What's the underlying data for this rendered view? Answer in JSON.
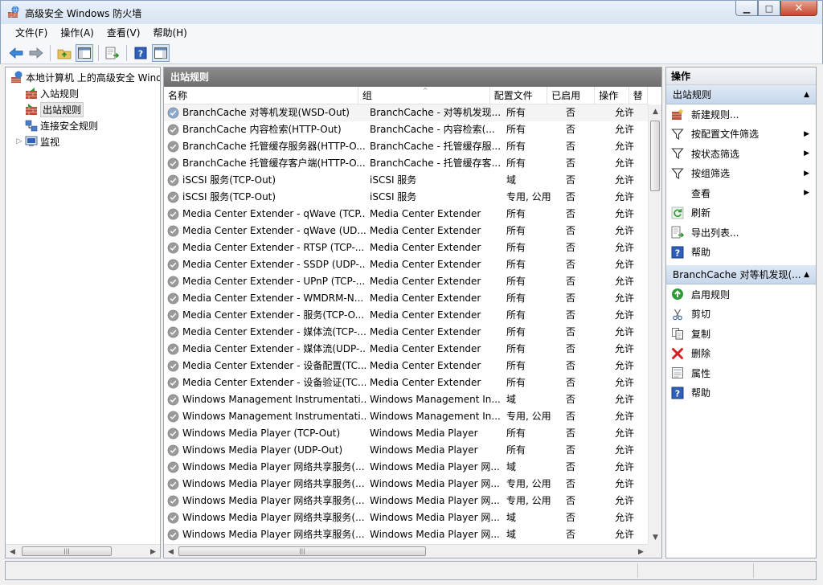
{
  "window": {
    "title": "高级安全 Windows 防火墙",
    "minimize_glyph": "▁",
    "maximize_glyph": "□",
    "close_glyph": "✕"
  },
  "menu": [
    "文件(F)",
    "操作(A)",
    "查看(V)",
    "帮助(H)"
  ],
  "toolbar": [
    "back-icon",
    "forward-icon",
    "up-folder-icon",
    "show-hide-tree-icon",
    "export-list-icon",
    "help-icon",
    "show-hide-action-pane-icon"
  ],
  "tree": {
    "root": "本地计算机 上的高级安全 Windows 防火墙",
    "items": [
      {
        "label": "入站规则",
        "selected": false
      },
      {
        "label": "出站规则",
        "selected": true
      },
      {
        "label": "连接安全规则",
        "selected": false
      },
      {
        "label": "监视",
        "selected": false,
        "expandable": true
      }
    ]
  },
  "center": {
    "title": "出站规则",
    "columns": [
      "名称",
      "组",
      "配置文件",
      "已启用",
      "操作",
      "替"
    ],
    "rows": [
      [
        "BranchCache 对等机发现(WSD-Out)",
        "BranchCache - 对等机发现...",
        "所有",
        "否",
        "允许"
      ],
      [
        "BranchCache 内容检索(HTTP-Out)",
        "BranchCache - 内容检索(...",
        "所有",
        "否",
        "允许"
      ],
      [
        "BranchCache 托管缓存服务器(HTTP-O...",
        "BranchCache - 托管缓存服...",
        "所有",
        "否",
        "允许"
      ],
      [
        "BranchCache 托管缓存客户端(HTTP-O...",
        "BranchCache - 托管缓存客...",
        "所有",
        "否",
        "允许"
      ],
      [
        "iSCSI 服务(TCP-Out)",
        "iSCSI 服务",
        "域",
        "否",
        "允许"
      ],
      [
        "iSCSI 服务(TCP-Out)",
        "iSCSI 服务",
        "专用, 公用",
        "否",
        "允许"
      ],
      [
        "Media Center Extender - qWave (TCP...",
        "Media Center Extender",
        "所有",
        "否",
        "允许"
      ],
      [
        "Media Center Extender - qWave (UD...",
        "Media Center Extender",
        "所有",
        "否",
        "允许"
      ],
      [
        "Media Center Extender - RTSP (TCP-...",
        "Media Center Extender",
        "所有",
        "否",
        "允许"
      ],
      [
        "Media Center Extender - SSDP (UDP-...",
        "Media Center Extender",
        "所有",
        "否",
        "允许"
      ],
      [
        "Media Center Extender - UPnP (TCP-...",
        "Media Center Extender",
        "所有",
        "否",
        "允许"
      ],
      [
        "Media Center Extender - WMDRM-N...",
        "Media Center Extender",
        "所有",
        "否",
        "允许"
      ],
      [
        "Media Center Extender - 服务(TCP-O...",
        "Media Center Extender",
        "所有",
        "否",
        "允许"
      ],
      [
        "Media Center Extender - 媒体流(TCP-...",
        "Media Center Extender",
        "所有",
        "否",
        "允许"
      ],
      [
        "Media Center Extender - 媒体流(UDP-...",
        "Media Center Extender",
        "所有",
        "否",
        "允许"
      ],
      [
        "Media Center Extender - 设备配置(TC...",
        "Media Center Extender",
        "所有",
        "否",
        "允许"
      ],
      [
        "Media Center Extender - 设备验证(TC...",
        "Media Center Extender",
        "所有",
        "否",
        "允许"
      ],
      [
        "Windows Management Instrumentati...",
        "Windows Management In...",
        "域",
        "否",
        "允许"
      ],
      [
        "Windows Management Instrumentati...",
        "Windows Management In...",
        "专用, 公用",
        "否",
        "允许"
      ],
      [
        "Windows Media Player (TCP-Out)",
        "Windows Media Player",
        "所有",
        "否",
        "允许"
      ],
      [
        "Windows Media Player (UDP-Out)",
        "Windows Media Player",
        "所有",
        "否",
        "允许"
      ],
      [
        "Windows Media Player 网络共享服务(...",
        "Windows Media Player 网...",
        "域",
        "否",
        "允许"
      ],
      [
        "Windows Media Player 网络共享服务(...",
        "Windows Media Player 网...",
        "专用, 公用",
        "否",
        "允许"
      ],
      [
        "Windows Media Player 网络共享服务(...",
        "Windows Media Player 网...",
        "专用, 公用",
        "否",
        "允许"
      ],
      [
        "Windows Media Player 网络共享服务(...",
        "Windows Media Player 网...",
        "域",
        "否",
        "允许"
      ],
      [
        "Windows Media Player 网络共享服务(...",
        "Windows Media Player 网...",
        "域",
        "否",
        "允许"
      ]
    ]
  },
  "actions": {
    "title": "操作",
    "sections": [
      {
        "title": "出站规则",
        "items": [
          {
            "label": "新建规则...",
            "icon": "new-rule-icon",
            "submenu": false
          },
          {
            "label": "按配置文件筛选",
            "icon": "filter-icon",
            "submenu": true
          },
          {
            "label": "按状态筛选",
            "icon": "filter-icon",
            "submenu": true
          },
          {
            "label": "按组筛选",
            "icon": "filter-icon",
            "submenu": true
          },
          {
            "label": "查看",
            "icon": "",
            "submenu": true
          },
          {
            "label": "刷新",
            "icon": "refresh-icon",
            "submenu": false
          },
          {
            "label": "导出列表...",
            "icon": "export-list-icon",
            "submenu": false
          },
          {
            "label": "帮助",
            "icon": "help-icon",
            "submenu": false
          }
        ]
      },
      {
        "title": "BranchCache 对等机发现(...",
        "items": [
          {
            "label": "启用规则",
            "icon": "enable-rule-icon",
            "submenu": false
          },
          {
            "label": "剪切",
            "icon": "cut-icon",
            "submenu": false
          },
          {
            "label": "复制",
            "icon": "copy-icon",
            "submenu": false
          },
          {
            "label": "删除",
            "icon": "delete-icon",
            "submenu": false
          },
          {
            "label": "属性",
            "icon": "properties-icon",
            "submenu": false
          },
          {
            "label": "帮助",
            "icon": "help-icon",
            "submenu": false
          }
        ]
      }
    ]
  },
  "colors": {
    "header_gray": "#7a7a7a",
    "section_blue": "#c6d7ec",
    "delete_red": "#d42020",
    "enable_green": "#2e9a36"
  }
}
